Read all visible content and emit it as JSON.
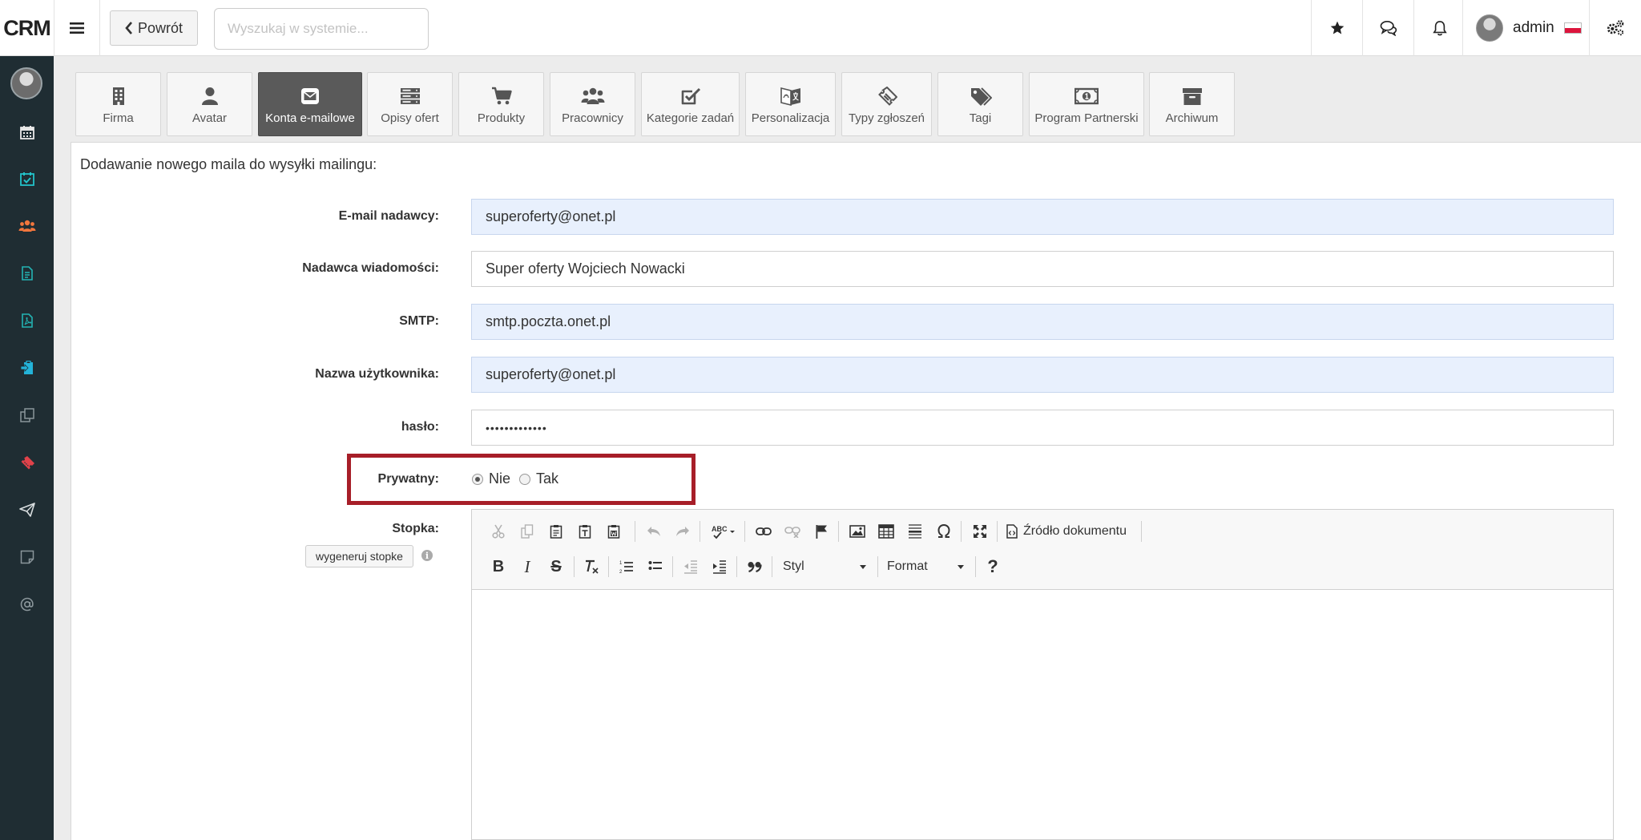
{
  "app": {
    "brand": "CRM"
  },
  "topbar": {
    "back_label": "Powrót",
    "search_placeholder": "Wyszukaj w systemie...",
    "user_name": "admin"
  },
  "tabs": [
    {
      "label": "Firma",
      "icon": "building-icon"
    },
    {
      "label": "Avatar",
      "icon": "user-icon"
    },
    {
      "label": "Konta e-mailowe",
      "icon": "envelope-icon",
      "active": true
    },
    {
      "label": "Opisy ofert",
      "icon": "server-icon"
    },
    {
      "label": "Produkty",
      "icon": "cart-icon"
    },
    {
      "label": "Pracownicy",
      "icon": "users-icon"
    },
    {
      "label": "Kategorie zadań",
      "icon": "checkbox-icon"
    },
    {
      "label": "Personalizacja",
      "icon": "translate-icon"
    },
    {
      "label": "Typy zgłoszeń",
      "icon": "ticket-icon"
    },
    {
      "label": "Tagi",
      "icon": "tags-icon"
    },
    {
      "label": "Program Partnerski",
      "icon": "money-icon"
    },
    {
      "label": "Archiwum",
      "icon": "archive-icon"
    }
  ],
  "form": {
    "title": "Dodawanie nowego maila do wysyłki mailingu:",
    "sender_email": {
      "label": "E-mail nadawcy:",
      "value": "superoferty@onet.pl"
    },
    "sender_name": {
      "label": "Nadawca wiadomości:",
      "value": "Super oferty Wojciech Nowacki"
    },
    "smtp": {
      "label": "SMTP:",
      "value": "smtp.poczta.onet.pl"
    },
    "username": {
      "label": "Nazwa użytkownika:",
      "value": "superoferty@onet.pl"
    },
    "password": {
      "label": "hasło:",
      "value": "•••••••••••••"
    },
    "private": {
      "label": "Prywatny:",
      "options": [
        "Nie",
        "Tak"
      ],
      "selected": "Nie"
    },
    "footer": {
      "label": "Stopka:",
      "generate_label": "wygeneruj stopke"
    }
  },
  "editor": {
    "source_label": "Źródło dokumentu",
    "style_label": "Styl",
    "format_label": "Format"
  },
  "colors": {
    "sidebar": "#1f2d33",
    "active_tab": "#5a5a5a",
    "highlight": "#a71e28",
    "autofill": "#e8f0fd"
  }
}
